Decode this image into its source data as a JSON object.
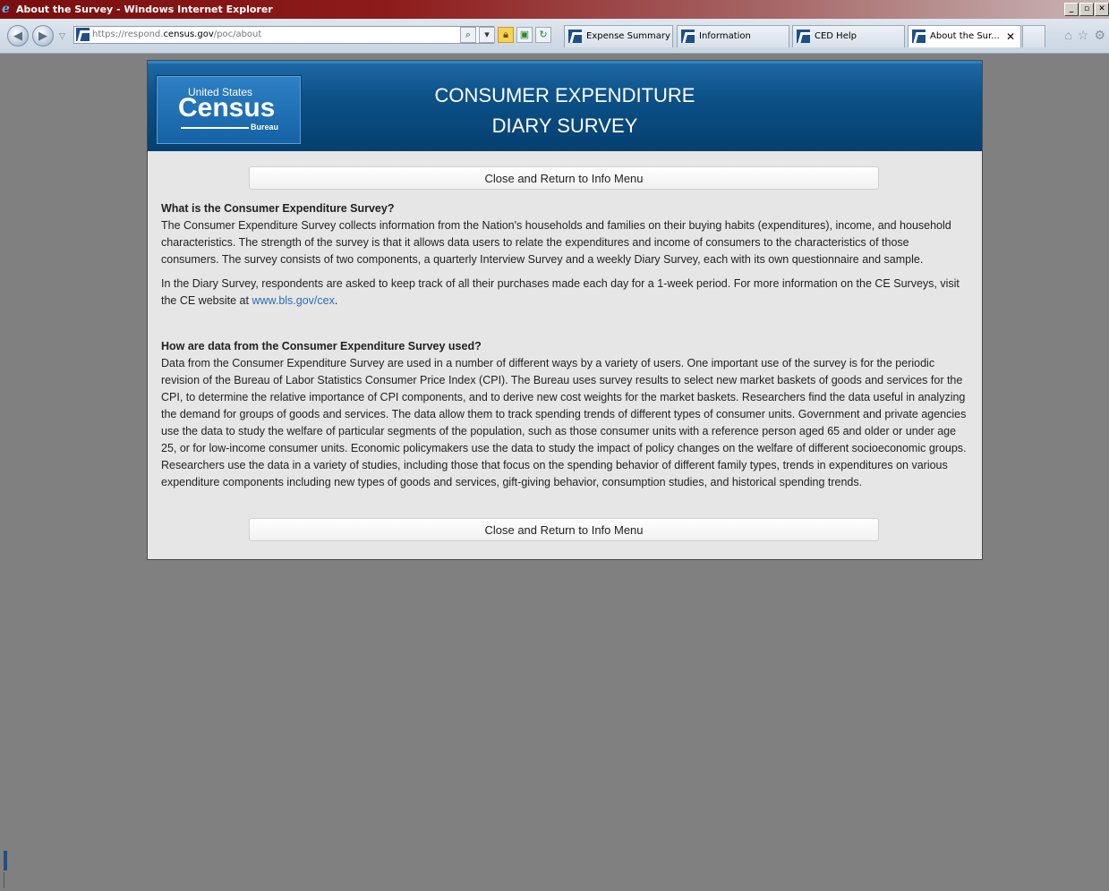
{
  "window": {
    "title": "About the Survey - Windows Internet Explorer",
    "controls": [
      "_",
      "▫",
      "✕"
    ]
  },
  "browser": {
    "url_host": "https://respond.",
    "url_domain": "census.gov",
    "url_path": "/poc/about",
    "tabs": [
      {
        "label": "Expense Summary"
      },
      {
        "label": "Information"
      },
      {
        "label": "CED Help"
      },
      {
        "label": "About the Sur...",
        "active": true
      }
    ],
    "tab_close": "✕"
  },
  "header": {
    "logo": {
      "line1": "United States",
      "line2": "Census",
      "line3": "Bureau"
    },
    "title_line1": "CONSUMER EXPENDITURE",
    "title_line2": "DIARY SURVEY"
  },
  "content": {
    "close_button_label": "Close and Return to Info Menu",
    "section1_heading": "What is the Consumer Expenditure Survey?",
    "section1_para1": "The Consumer Expenditure Survey collects information from the Nation's households and families on their buying habits (expenditures), income, and household characteristics. The strength of the survey is that it allows data users to relate the expenditures and income of consumers to the characteristics of those consumers. The survey consists of two components, a quarterly Interview Survey and a weekly Diary Survey, each with its own questionnaire and sample.",
    "section1_para2_before": "In the Diary Survey, respondents are asked to keep track of all their purchases made each day for a 1-week period. For more information on the CE Surveys, visit the CE website at ",
    "section1_link": "www.bls.gov/cex",
    "section1_para2_after": ".",
    "section2_heading": "How are data from the Consumer Expenditure Survey used?",
    "section2_para": "Data from the Consumer Expenditure Survey are used in a number of different ways by a variety of users. One important use of the survey is for the periodic revision of the Bureau of Labor Statistics Consumer Price Index (CPI). The Bureau uses survey results to select new market baskets of goods and services for the CPI, to determine the relative importance of CPI components, and to derive new cost weights for the market baskets. Researchers find the data useful in analyzing the demand for groups of goods and services. The data allow them to track spending trends of different types of consumer units. Government and private agencies use the data to study the welfare of particular segments of the population, such as those consumer units with a reference person aged 65 and older or under age 25, or for low-income consumer units. Economic policymakers use the data to study the impact of policy changes on the welfare of different socioeconomic groups. Researchers use the data in a variety of studies, including those that focus on the spending behavior of different family types, trends in expenditures on various expenditure components including new types of goods and services, gift-giving behavior, consumption studies, and historical spending trends."
  },
  "colors": {
    "header_blue": "#0c5188",
    "link_blue": "#2a6ebb",
    "page_bg": "#808080"
  },
  "icons": {
    "back": "back-arrow-icon",
    "forward": "forward-arrow-icon",
    "search": "search-icon",
    "lock": "lock-icon",
    "home": "home-icon",
    "favorites": "star-icon",
    "tools": "gear-icon"
  }
}
